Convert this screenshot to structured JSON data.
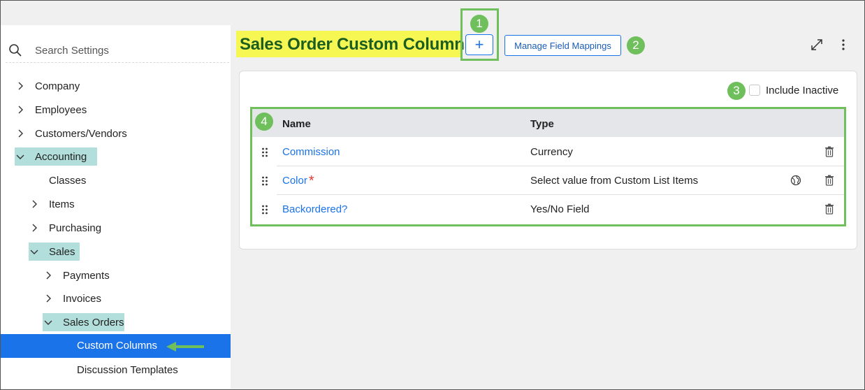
{
  "sidebar": {
    "search_placeholder": "Search Settings",
    "items": [
      {
        "label": "Company"
      },
      {
        "label": "Employees"
      },
      {
        "label": "Customers/Vendors"
      },
      {
        "label": "Accounting"
      },
      {
        "label": "Classes"
      },
      {
        "label": "Items"
      },
      {
        "label": "Purchasing"
      },
      {
        "label": "Sales"
      },
      {
        "label": "Payments"
      },
      {
        "label": "Invoices"
      },
      {
        "label": "Sales Orders"
      },
      {
        "label": "Custom Columns"
      },
      {
        "label": "Discussion Templates"
      }
    ]
  },
  "header": {
    "title": "Sales Order Custom Columns",
    "add_label": "+",
    "manage_label": "Manage Field Mappings"
  },
  "callouts": [
    "1",
    "2",
    "3",
    "4"
  ],
  "filters": {
    "include_inactive_label": "Include Inactive",
    "include_inactive_checked": false
  },
  "table": {
    "columns": [
      "Name",
      "Type"
    ],
    "rows": [
      {
        "name": "Commission",
        "type": "Currency",
        "required": false
      },
      {
        "name": "Color",
        "type": "Select value from Custom List Items",
        "required": true
      },
      {
        "name": "Backordered?",
        "type": "Yes/No Field",
        "required": false
      }
    ],
    "required_marker": "*"
  },
  "colors": {
    "accent": "#1a73e8",
    "highlight_teal": "#b2dfdb",
    "callout_green": "#6fbf5c",
    "title_highlight": "#f7f754",
    "title_text": "#1b5e20"
  }
}
